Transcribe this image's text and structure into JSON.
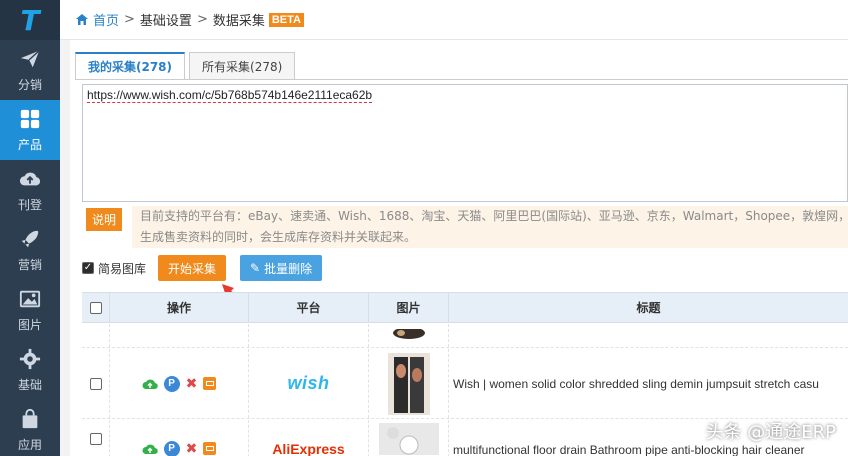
{
  "sidebar": {
    "logo_text": "T",
    "items": [
      {
        "label": "分销",
        "icon": "paper-plane-icon",
        "active": false
      },
      {
        "label": "产品",
        "icon": "grid-icon",
        "active": true
      },
      {
        "label": "刊登",
        "icon": "cloud-upload-icon",
        "active": false
      },
      {
        "label": "营销",
        "icon": "rocket-icon",
        "active": false
      },
      {
        "label": "图片",
        "icon": "image-icon",
        "active": false
      },
      {
        "label": "基础",
        "icon": "gear-icon",
        "active": false
      },
      {
        "label": "应用",
        "icon": "shopping-bag-icon",
        "active": false
      }
    ]
  },
  "breadcrumb": {
    "home": "首页",
    "sep1": ">",
    "level2": "基础设置",
    "sep2": ">",
    "current": "数据采集",
    "badge": "BETA"
  },
  "tabs": [
    {
      "label": "我的采集(278)",
      "active": true
    },
    {
      "label": "所有采集(278)",
      "active": false
    }
  ],
  "url_input": {
    "value": "https://www.wish.com/c/5b768b574b146e2111eca62b"
  },
  "note": {
    "badge": "说明",
    "line1": "目前支持的平台有：eBay、速卖通、Wish、1688、淘宝、天猫、阿里巴巴(国际站)、亚马逊、京东，Walmart，Shopee，敦煌网，Jo",
    "line2": "生成售卖资料的同时，会生成库存资料并关联起来。"
  },
  "actions": {
    "simple_gallery_label": "简易图库",
    "simple_gallery_checked": true,
    "start_button": "开始采集",
    "batch_delete_button": "批量删除"
  },
  "table": {
    "headers": [
      "操作",
      "平台",
      "图片",
      "标题"
    ],
    "rows": [
      {
        "platform": "wish",
        "title": "Wish | women solid color shredded sling demin jumpsuit stretch casu"
      },
      {
        "platform": "AliExpress",
        "title": "multifunctional floor drain Bathroom pipe anti-blocking hair cleaner"
      }
    ]
  },
  "watermark": "头条 @通途ERP",
  "colors": {
    "sidebar_bg": "#2d3e50",
    "active_nav": "#1f8fd8",
    "accent_orange": "#f08a1c",
    "accent_blue": "#4aa3e0",
    "link_blue": "#2a7fc9"
  }
}
